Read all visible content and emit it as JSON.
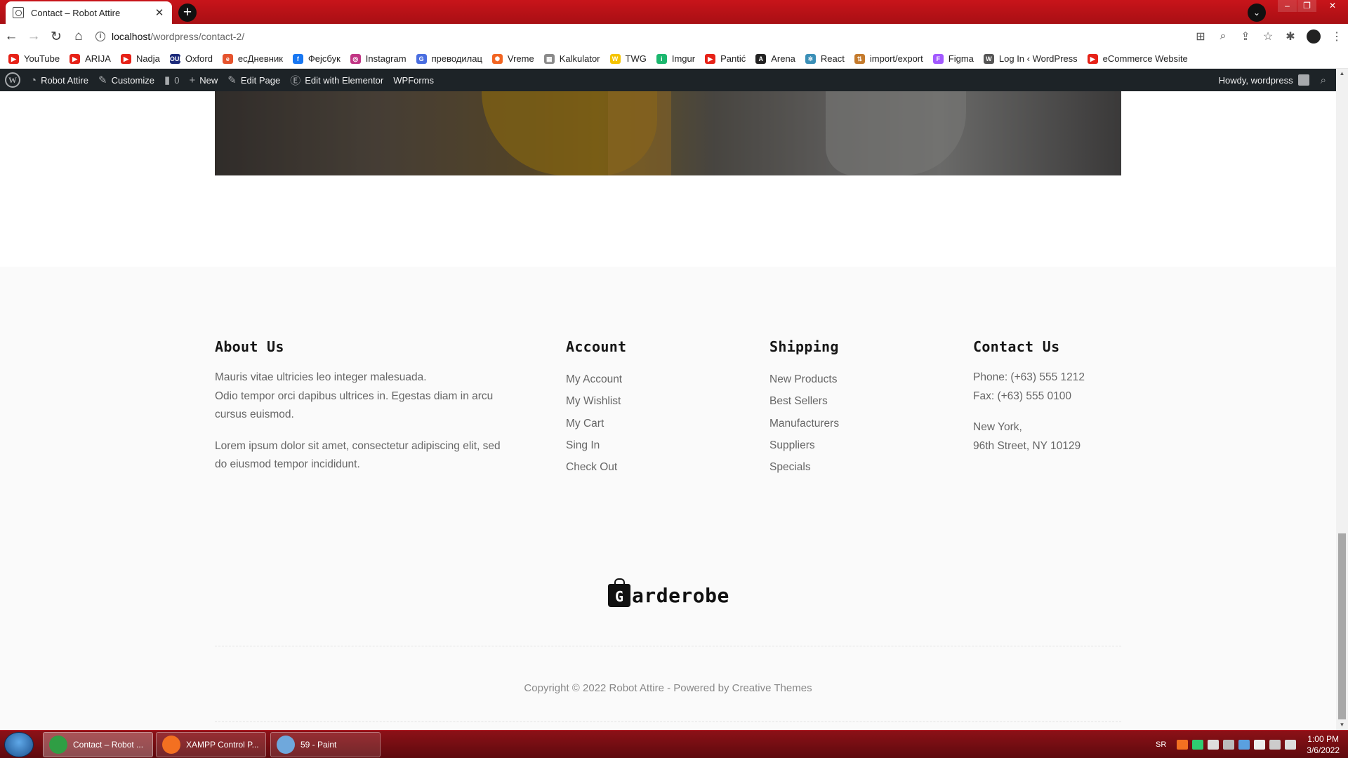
{
  "browser": {
    "tab_title": "Contact – Robot Attire",
    "url_host": "localhost",
    "url_path": "/wordpress/contact-2/"
  },
  "bookmarks": [
    {
      "label": "YouTube",
      "color": "#e62117",
      "glyph": "▶"
    },
    {
      "label": "ARIJA",
      "color": "#e62117",
      "glyph": "▶"
    },
    {
      "label": "Nadja",
      "color": "#e62117",
      "glyph": "▶"
    },
    {
      "label": "Oxford",
      "color": "#1b2a7a",
      "glyph": "OUP"
    },
    {
      "label": "есДневник",
      "color": "#e5532d",
      "glyph": "e"
    },
    {
      "label": "Фејсбук",
      "color": "#1877f2",
      "glyph": "f"
    },
    {
      "label": "Instagram",
      "color": "#c13584",
      "glyph": "◎"
    },
    {
      "label": "преводилац",
      "color": "#4a6ee0",
      "glyph": "G"
    },
    {
      "label": "Vreme",
      "color": "#f26522",
      "glyph": "✺"
    },
    {
      "label": "Kalkulator",
      "color": "#8a8a8a",
      "glyph": "▦"
    },
    {
      "label": "TWG",
      "color": "#f5c400",
      "glyph": "W"
    },
    {
      "label": "Imgur",
      "color": "#1bb76e",
      "glyph": "i"
    },
    {
      "label": "Pantić",
      "color": "#e62117",
      "glyph": "▶"
    },
    {
      "label": "Arena",
      "color": "#222222",
      "glyph": "A"
    },
    {
      "label": "React",
      "color": "#3a8fb7",
      "glyph": "⚛"
    },
    {
      "label": "import/export",
      "color": "#c47a2c",
      "glyph": "⇅"
    },
    {
      "label": "Figma",
      "color": "#a259ff",
      "glyph": "F"
    },
    {
      "label": "Log In ‹ WordPress",
      "color": "#555555",
      "glyph": "W"
    },
    {
      "label": "eCommerce Website",
      "color": "#e62117",
      "glyph": "▶"
    }
  ],
  "adminbar": {
    "site_name": "Robot Attire",
    "customize": "Customize",
    "comments_count": "0",
    "new": "New",
    "edit_page": "Edit Page",
    "elementor": "Edit with Elementor",
    "wpforms": "WPForms",
    "howdy": "Howdy, wordpress"
  },
  "footer": {
    "about": {
      "heading": "About Us",
      "p1_line1": "Mauris vitae ultricies leo integer malesuada.",
      "p1_line2": "Odio tempor orci dapibus ultrices in. Egestas diam in arcu",
      "p1_line3": "cursus euismod.",
      "p2_line1": "Lorem ipsum dolor sit amet, consectetur adipiscing elit, sed",
      "p2_line2": "do eiusmod tempor incididunt."
    },
    "account": {
      "heading": "Account",
      "links": [
        "My Account",
        "My Wishlist",
        "My Cart",
        "Sing In",
        "Check Out"
      ]
    },
    "shipping": {
      "heading": "Shipping",
      "links": [
        "New Products",
        "Best Sellers",
        "Manufacturers",
        "Suppliers",
        "Specials"
      ]
    },
    "contact": {
      "heading": "Contact Us",
      "phone": "Phone: (+63) 555 1212",
      "fax": "Fax: (+63) 555 0100",
      "city": "New York,",
      "street": "96th Street, NY 10129"
    },
    "logo_letter": "G",
    "logo_text": "arderobe",
    "copyright": "Copyright © 2022 Robot Attire - Powered by Creative Themes"
  },
  "taskbar": {
    "items": [
      {
        "label": "Contact – Robot ...",
        "icon_color": "#2f9e44"
      },
      {
        "label": "XAMPP Control P...",
        "icon_color": "#f37021"
      },
      {
        "label": "59 - Paint",
        "icon_color": "#6fa8dc"
      }
    ],
    "lang": "SR",
    "time": "1:00 PM",
    "date": "3/6/2022"
  }
}
